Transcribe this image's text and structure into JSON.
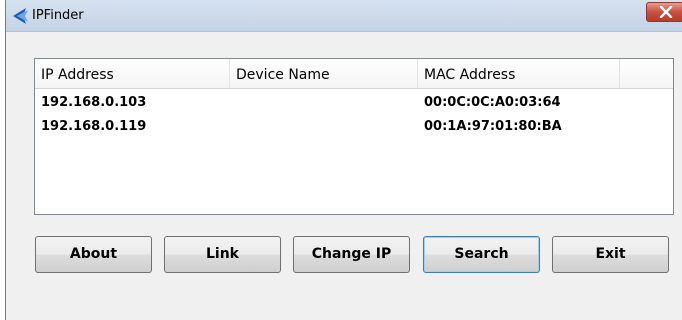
{
  "window": {
    "title": "IPFinder",
    "icon": "ipfinder-app-icon",
    "close_icon": "close-icon",
    "colors": {
      "close_button": "#c8513e",
      "title_bar": "#c3d3e6",
      "default_button_border": "#3c7fb1"
    }
  },
  "table": {
    "columns": [
      "IP Address",
      "Device Name",
      "MAC Address"
    ],
    "rows": [
      {
        "ip": "192.168.0.103",
        "device": "",
        "mac": "00:0C:0C:A0:03:64"
      },
      {
        "ip": "192.168.0.119",
        "device": "",
        "mac": "00:1A:97:01:80:BA"
      }
    ]
  },
  "buttons": {
    "about": "About",
    "link": "Link",
    "change_ip": "Change IP",
    "search": "Search",
    "exit": "Exit"
  }
}
